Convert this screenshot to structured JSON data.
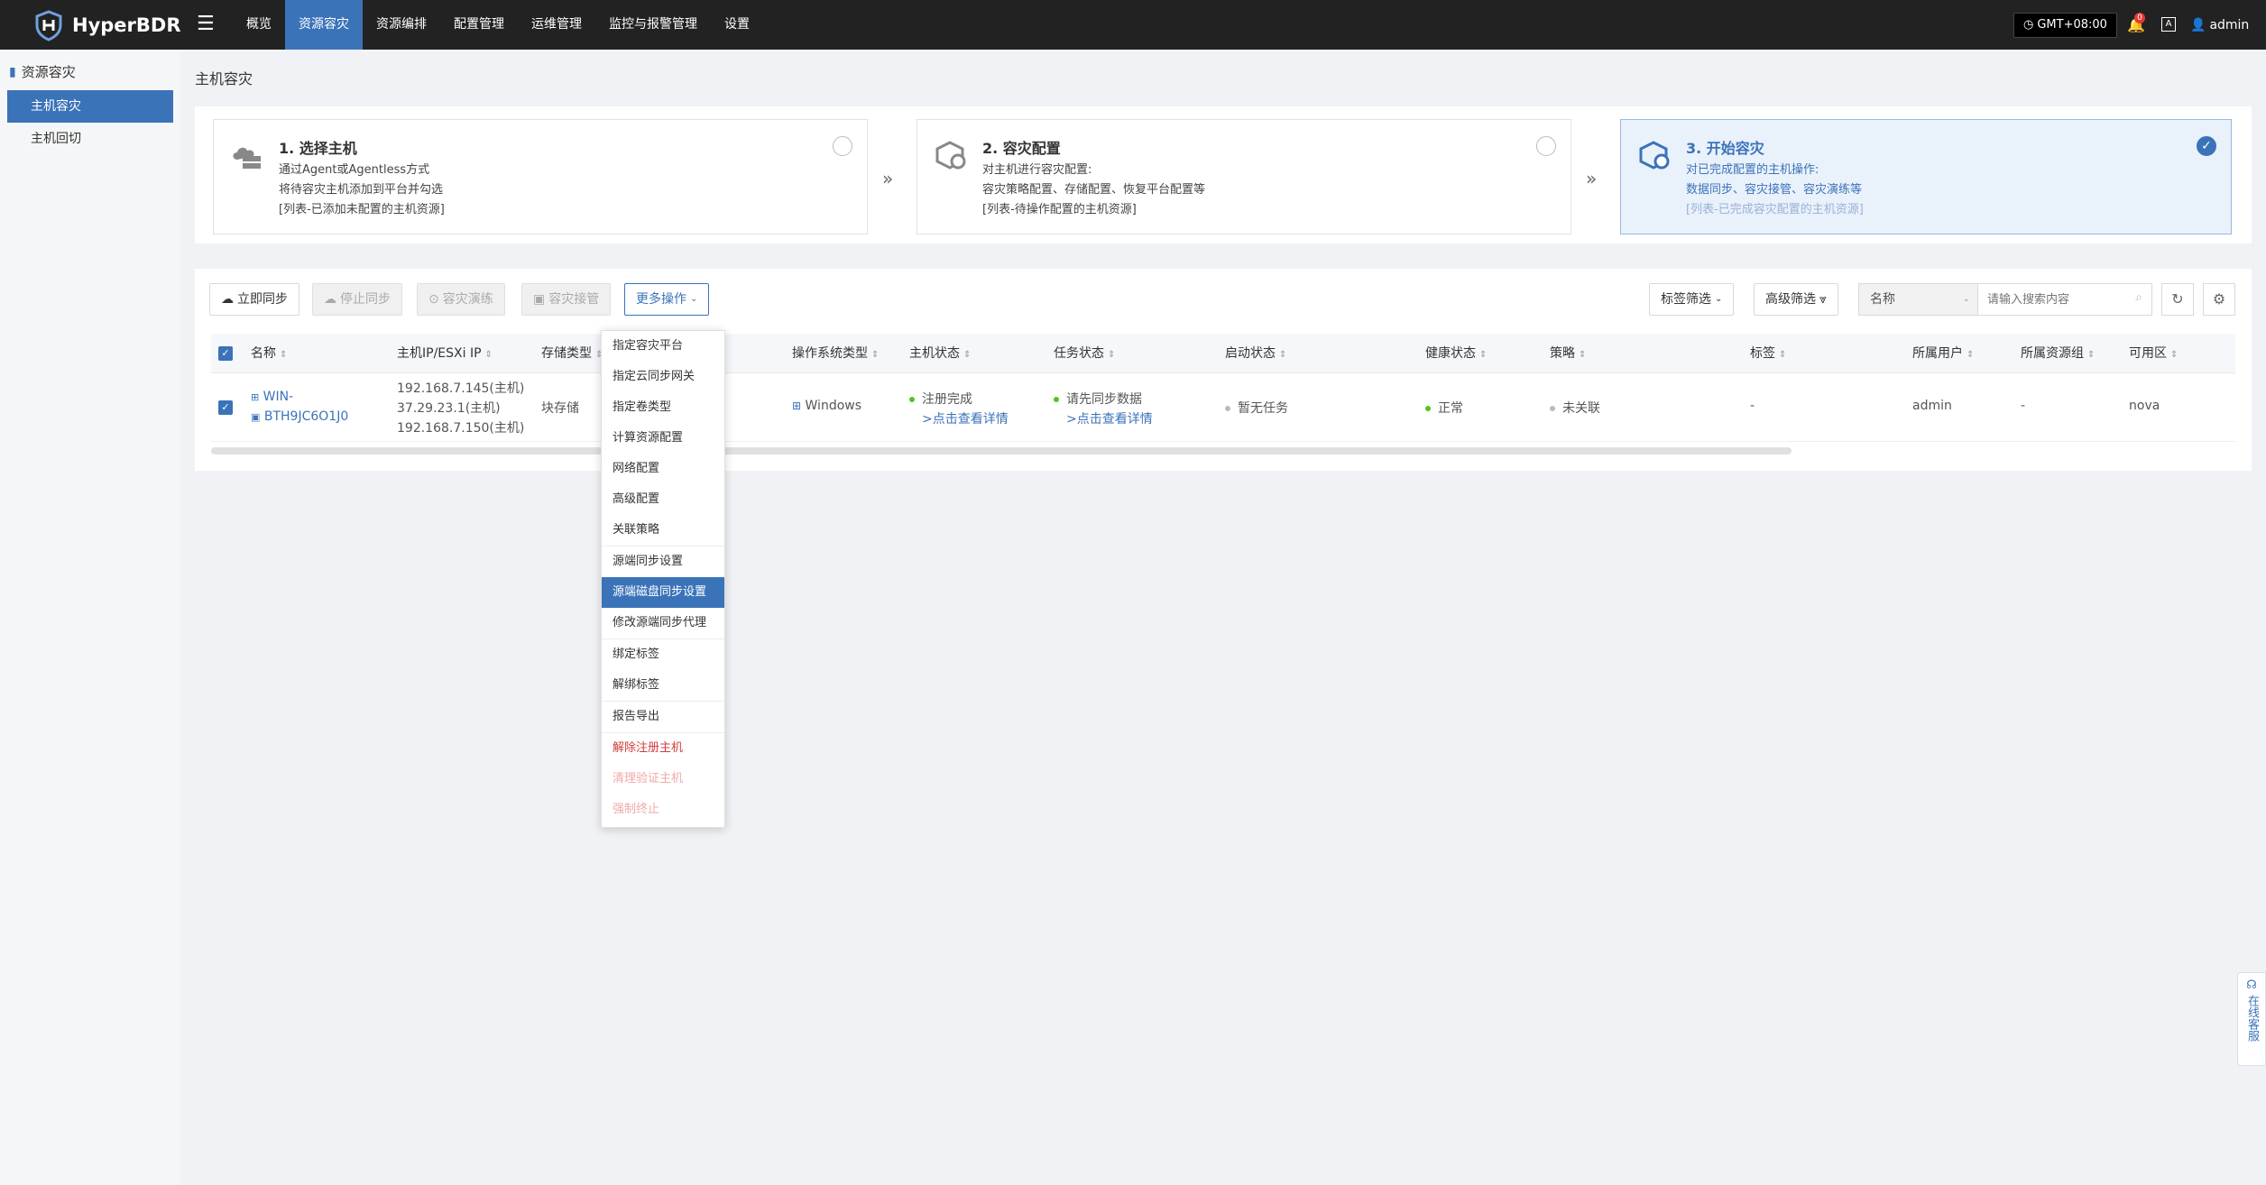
{
  "app": {
    "name": "HyperBDR"
  },
  "nav": {
    "items": [
      "概览",
      "资源容灾",
      "资源编排",
      "配置管理",
      "运维管理",
      "监控与报警管理",
      "设置"
    ],
    "active_index": 1
  },
  "header": {
    "timezone": "GMT+08:00",
    "notification_count": "0",
    "lang_label": "A",
    "user": "admin"
  },
  "sidebar": {
    "title": "资源容灾",
    "items": [
      {
        "label": "主机容灾",
        "active": true
      },
      {
        "label": "主机回切",
        "active": false
      }
    ]
  },
  "page": {
    "title": "主机容灾"
  },
  "steps": [
    {
      "title": "1. 选择主机",
      "lines": [
        "通过Agent或Agentless方式",
        "将待容灾主机添加到平台并勾选",
        "[列表-已添加未配置的主机资源]"
      ],
      "checked": false
    },
    {
      "title": "2. 容灾配置",
      "lines": [
        "对主机进行容灾配置:",
        "容灾策略配置、存储配置、恢复平台配置等",
        "[列表-待操作配置的主机资源]"
      ],
      "checked": false
    },
    {
      "title": "3. 开始容灾",
      "lines": [
        "对已完成配置的主机操作:",
        "数据同步、容灾接管、容灾演练等",
        "[列表-已完成容灾配置的主机资源]"
      ],
      "checked": true
    }
  ],
  "toolbar": {
    "sync_now": "立即同步",
    "stop_sync": "停止同步",
    "drill": "容灾演练",
    "takeover": "容灾接管",
    "more": "更多操作",
    "tag_filter": "标签筛选",
    "advanced_filter": "高级筛选",
    "search_field": "名称",
    "search_placeholder": "请输入搜索内容"
  },
  "table": {
    "columns": [
      "名称",
      "主机IP/ESXi IP",
      "存储类型",
      "操作系统类型",
      "主机状态",
      "任务状态",
      "启动状态",
      "健康状态",
      "策略",
      "标签",
      "所属用户",
      "所属资源组",
      "可用区"
    ],
    "rows": [
      {
        "name_line1": "WIN-",
        "name_line2": "BTH9JC6O1J0",
        "ips": [
          "192.168.7.145(主机)",
          "37.29.23.1(主机)",
          "192.168.7.150(主机)"
        ],
        "storage": "块存储",
        "os": "Windows",
        "host_status": "注册完成",
        "host_status_link": ">点击查看详情",
        "task_status": "请先同步数据",
        "task_status_link": ">点击查看详情",
        "boot_status": "暂无任务",
        "health": "正常",
        "policy": "未关联",
        "tag": "-",
        "owner": "admin",
        "resource_group": "-",
        "zone": "nova"
      }
    ]
  },
  "more_menu": {
    "items": [
      "指定容灾平台",
      "指定云同步网关",
      "指定卷类型",
      "计算资源配置",
      "网络配置",
      "高级配置",
      "关联策略",
      "源端同步设置",
      "源端磁盘同步设置",
      "修改源端同步代理",
      "绑定标签",
      "解绑标签",
      "报告导出",
      "解除注册主机",
      "清理验证主机",
      "强制终止"
    ],
    "active_index": 8
  },
  "float_service": {
    "label": "在线客服"
  },
  "colors": {
    "primary": "#3b73b9",
    "topbar": "#222222",
    "danger": "#d23c3c"
  }
}
